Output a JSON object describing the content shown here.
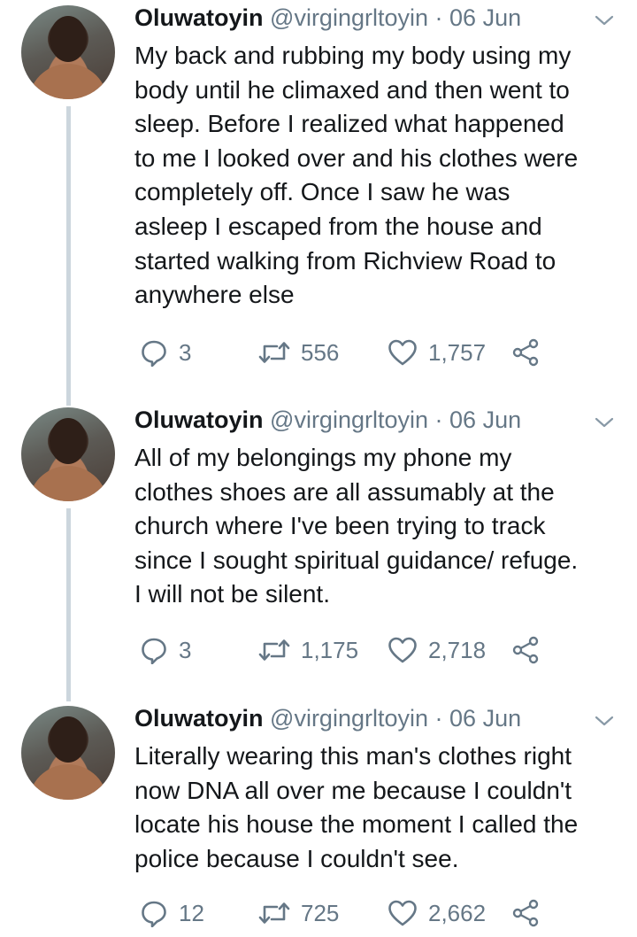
{
  "tweets": [
    {
      "name": "Oluwatoyin",
      "handle": "@virgingrltoyin",
      "separator": "·",
      "date": "06 Jun",
      "text_lines": [
        "My back and rubbing my body using my",
        "body until he climaxed and then went to",
        "sleep. Before I realized what happened",
        "to me I looked over and his clothes were",
        "completely off. Once I saw he was",
        "asleep I escaped from the house and",
        "started walking from Richview Road to",
        "anywhere else"
      ],
      "replies": "3",
      "retweets": "556",
      "likes": "1,757"
    },
    {
      "name": "Oluwatoyin",
      "handle": "@virgingrltoyin",
      "separator": "·",
      "date": "06 Jun",
      "text_lines": [
        "All of my belongings my phone my",
        "clothes shoes are all assumably at the",
        "church where I've been trying to track",
        "since I sought spiritual guidance/ refuge.",
        "I will not be silent."
      ],
      "replies": "3",
      "retweets": "1,175",
      "likes": "2,718"
    },
    {
      "name": "Oluwatoyin",
      "handle": "@virgingrltoyin",
      "separator": "·",
      "date": "06 Jun",
      "text_lines": [
        "Literally wearing this man's clothes right",
        "now DNA all over me because I couldn't",
        "locate his house the moment I called the",
        "police because I couldn't see."
      ],
      "replies": "12",
      "retweets": "725",
      "likes": "2,662"
    }
  ],
  "icons": {
    "reply": "reply-icon",
    "retweet": "retweet-icon",
    "like": "heart-icon",
    "share": "share-icon",
    "menu": "chevron-down-icon"
  },
  "colors": {
    "text": "#14171a",
    "secondary": "#657786",
    "thread_line": "#ccd6dd"
  }
}
